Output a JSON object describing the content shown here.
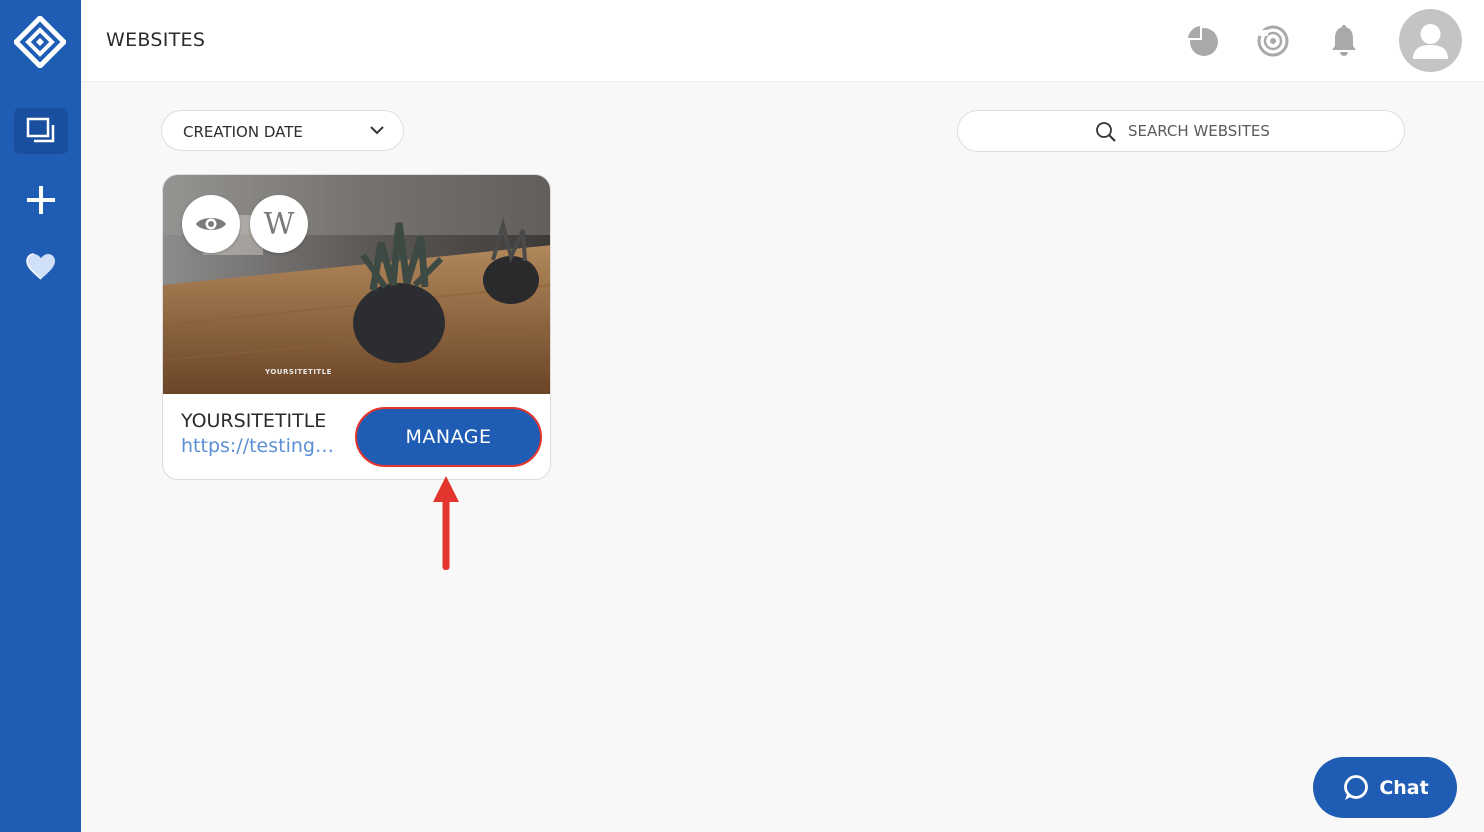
{
  "header": {
    "title": "WEBSITES"
  },
  "sidebar": {
    "items": [
      {
        "icon": "websites-icon",
        "active": true
      },
      {
        "icon": "plus-icon"
      },
      {
        "icon": "heart-icon"
      }
    ]
  },
  "toolbar": {
    "sort": {
      "selected": "CREATION DATE",
      "icon": "chevron-down-icon"
    },
    "search": {
      "placeholder": "SEARCH WEBSITES",
      "value": ""
    }
  },
  "sites": [
    {
      "thumbnail_text": "YOURSITETITLE",
      "title": "YOURSITETITLE",
      "url": "https://testing…",
      "actions": {
        "preview_icon": "eye-icon",
        "wordpress_icon": "wordpress-icon",
        "wordpress_letter": "W"
      },
      "manage_label": "MANAGE"
    }
  ],
  "chat": {
    "label": "Chat"
  },
  "colors": {
    "brand": "#1f5db5",
    "annotation": "#e3352e",
    "link": "#5b8fd6",
    "background": "#f8f8f8"
  }
}
